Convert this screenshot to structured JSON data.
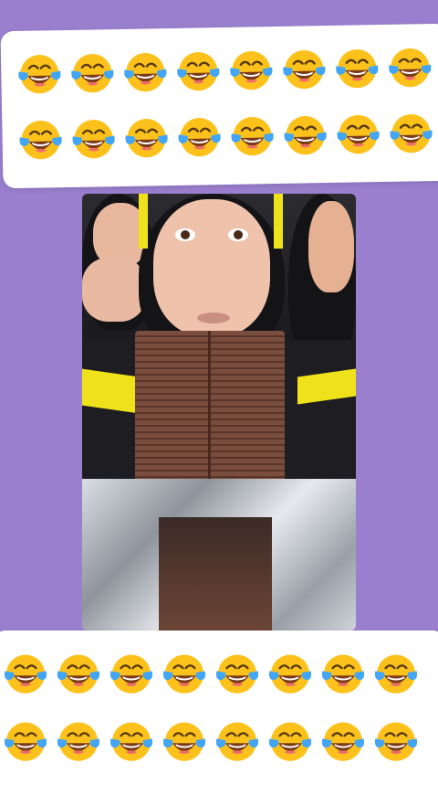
{
  "top_banner": {
    "rows": [
      [
        "face-with-tears-of-joy",
        "face-with-tears-of-joy",
        "face-with-tears-of-joy",
        "face-with-tears-of-joy",
        "face-with-tears-of-joy",
        "face-with-tears-of-joy",
        "face-with-tears-of-joy",
        "face-with-tears-of-joy"
      ],
      [
        "face-with-tears-of-joy",
        "face-with-tears-of-joy",
        "face-with-tears-of-joy",
        "face-with-tears-of-joy",
        "face-with-tears-of-joy",
        "face-with-tears-of-joy",
        "face-with-tears-of-joy",
        "face-with-tears-of-joy"
      ]
    ]
  },
  "bottom_banner": {
    "rows": [
      [
        "face-with-tears-of-joy",
        "face-with-tears-of-joy",
        "face-with-tears-of-joy",
        "face-with-tears-of-joy",
        "face-with-tears-of-joy",
        "face-with-tears-of-joy",
        "face-with-tears-of-joy",
        "face-with-tears-of-joy"
      ],
      [
        "face-with-tears-of-joy",
        "face-with-tears-of-joy",
        "face-with-tears-of-joy",
        "face-with-tears-of-joy",
        "face-with-tears-of-joy",
        "face-with-tears-of-joy",
        "face-with-tears-of-joy",
        "face-with-tears-of-joy"
      ]
    ]
  },
  "colors": {
    "background": "#9a7fcf",
    "card": "#ffffff",
    "emoji_face": "#fcc21b",
    "tears": "#42a5f5",
    "hood_stripe": "#f0e21a",
    "chocolate": "#7a4e3e"
  }
}
